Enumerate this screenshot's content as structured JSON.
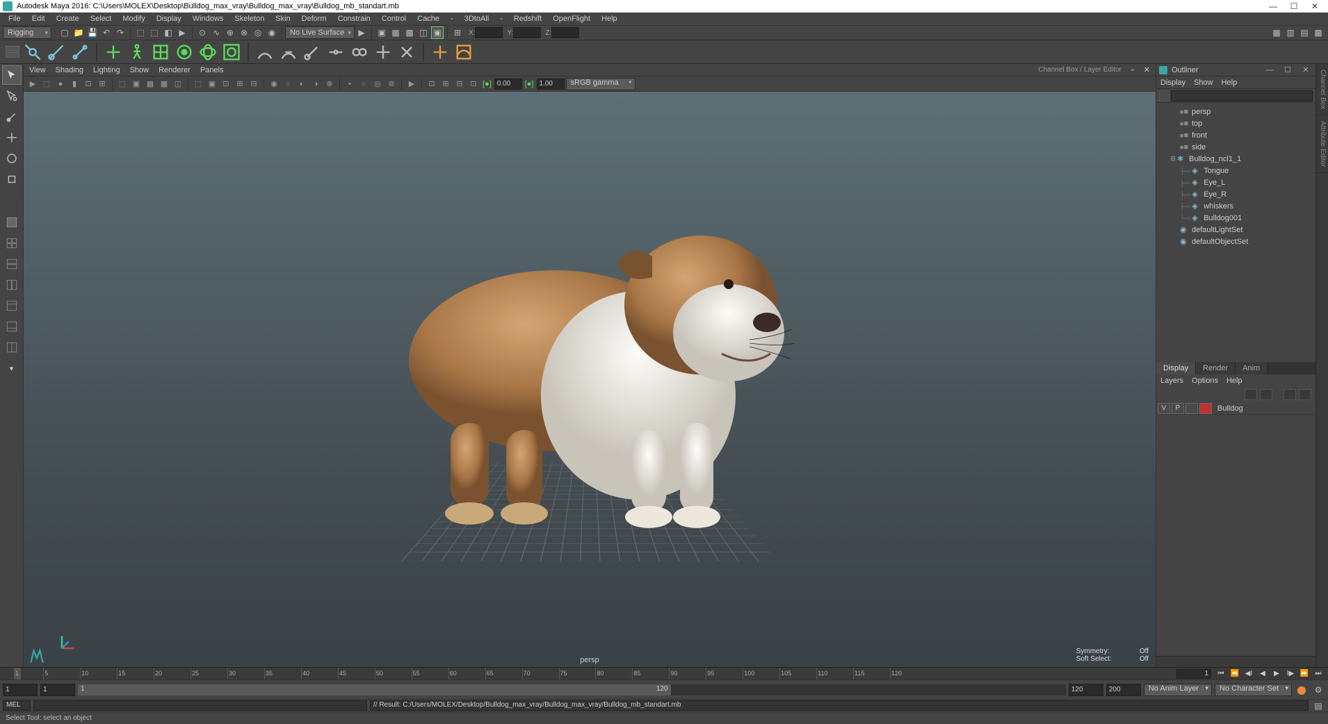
{
  "titlebar": {
    "app": "Autodesk Maya 2016:",
    "path": "C:\\Users\\MOLEX\\Desktop\\Bulldog_max_vray\\Bulldog_max_vray\\Bulldog_mb_standart.mb"
  },
  "menubar": [
    "File",
    "Edit",
    "Create",
    "Select",
    "Modify",
    "Display",
    "Windows",
    "Skeleton",
    "Skin",
    "Deform",
    "Constrain",
    "Control",
    "Cache",
    "-",
    "3DtoAll",
    "-",
    "Redshift",
    "OpenFlight",
    "Help"
  ],
  "workspace_dropdown": "Rigging",
  "live_surface": "No Live Surface",
  "coords": {
    "x": "X:",
    "y": "Y:",
    "z": "Z:"
  },
  "panelmenu": [
    "View",
    "Shading",
    "Lighting",
    "Show",
    "Renderer",
    "Panels"
  ],
  "channel_box_title": "Channel Box / Layer Editor",
  "gamma": {
    "near": "0.00",
    "far": "1.00",
    "mode": "sRGB gamma"
  },
  "viewport_overlay": {
    "camera": "persp",
    "symmetry_label": "Symmetry:",
    "symmetry_value": "Off",
    "softselect_label": "Soft Select:",
    "softselect_value": "Off"
  },
  "outliner": {
    "title": "Outliner",
    "menu": [
      "Display",
      "Show",
      "Help"
    ],
    "nodes": [
      {
        "name": "persp",
        "type": "camera",
        "depth": 0
      },
      {
        "name": "top",
        "type": "camera",
        "depth": 0
      },
      {
        "name": "front",
        "type": "camera",
        "depth": 0
      },
      {
        "name": "side",
        "type": "camera",
        "depth": 0
      },
      {
        "name": "Bulldog_ncl1_1",
        "type": "transform",
        "depth": 0,
        "expanded": true
      },
      {
        "name": "Tongue",
        "type": "mesh",
        "depth": 1
      },
      {
        "name": "Eye_L",
        "type": "mesh",
        "depth": 1
      },
      {
        "name": "Eye_R",
        "type": "mesh",
        "depth": 1
      },
      {
        "name": "whiskers",
        "type": "mesh",
        "depth": 1
      },
      {
        "name": "Bulldog001",
        "type": "mesh",
        "depth": 1
      },
      {
        "name": "defaultLightSet",
        "type": "set",
        "depth": 0
      },
      {
        "name": "defaultObjectSet",
        "type": "set",
        "depth": 0
      }
    ]
  },
  "channel_tabs": [
    "Display",
    "Render",
    "Anim"
  ],
  "layers_menu": [
    "Layers",
    "Options",
    "Help"
  ],
  "layer_row": {
    "v": "V",
    "p": "P",
    "name": "Bulldog",
    "color": "#b82e2e"
  },
  "timeslider": {
    "start": 1,
    "end": 120,
    "ticks": [
      1,
      5,
      10,
      15,
      20,
      25,
      30,
      35,
      40,
      45,
      50,
      55,
      60,
      65,
      70,
      75,
      80,
      85,
      90,
      95,
      100,
      105,
      110,
      115,
      120
    ],
    "current": 1
  },
  "range": {
    "start": "1",
    "in": "1",
    "out": "120",
    "end": "120",
    "inner": "120",
    "outer": "200",
    "animlayer": "No Anim Layer",
    "charset": "No Character Set"
  },
  "command": {
    "lang": "MEL",
    "result": "// Result: C:/Users/MOLEX/Desktop/Bulldog_max_vray/Bulldog_max_vray/Bulldog_mb_standart.mb"
  },
  "helpline": "Select Tool: select an object"
}
